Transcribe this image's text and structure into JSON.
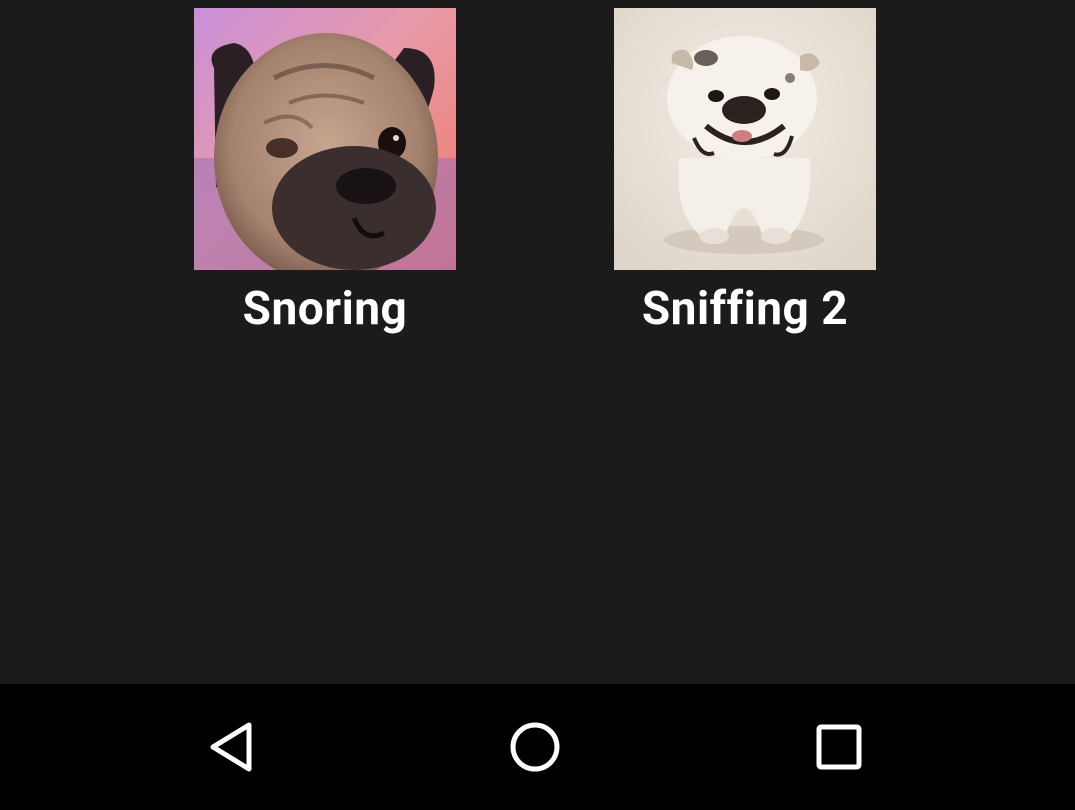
{
  "grid": {
    "items": [
      {
        "label": "Snoring",
        "image": "pug-photo"
      },
      {
        "label": "Sniffing 2",
        "image": "bulldog-photo"
      }
    ]
  },
  "navbar": {
    "back_icon": "back-icon",
    "home_icon": "home-icon",
    "recents_icon": "recents-icon"
  },
  "colors": {
    "background": "#1b1b1b",
    "navbar": "#000000",
    "label": "#ffffff"
  }
}
